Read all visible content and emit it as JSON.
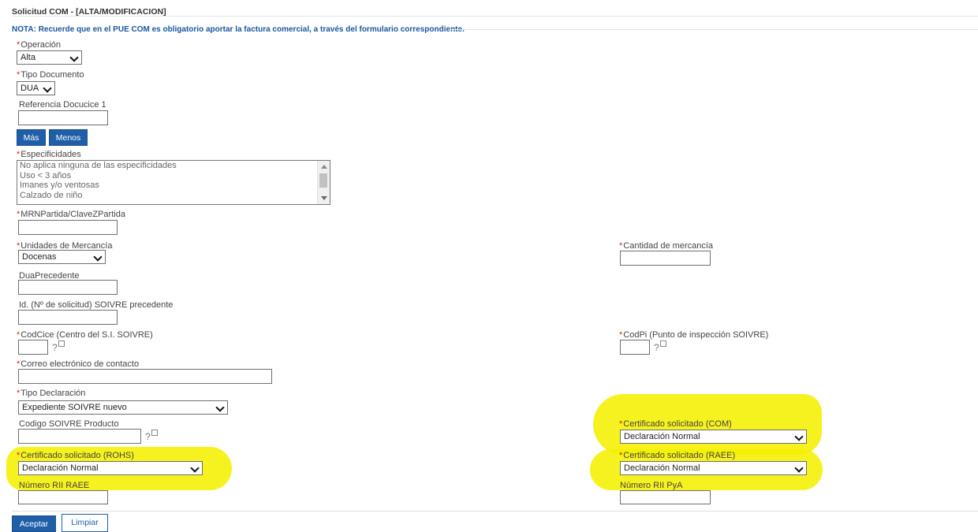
{
  "header": {
    "title": "Solicitud COM - [ALTA/MODIFICACION]",
    "note": "NOTA: Recuerde que en el PUE COM es obligatorio aportar la factura comercial, a través del formulario correspondiente."
  },
  "required_marker": "*",
  "help_icon_text": "?",
  "fields": {
    "operacion": {
      "label": "Operación",
      "value": "Alta"
    },
    "tipo_documento": {
      "label": "Tipo Documento",
      "value": "DUA"
    },
    "referencia": {
      "label": "Referencia Docucice 1",
      "value": ""
    },
    "especificidades": {
      "label": "Especificidades",
      "options": [
        "No aplica ninguna de las especificidades",
        "Uso < 3 años",
        "Imanes y/o ventosas",
        "Calzado de niño"
      ]
    },
    "mrn": {
      "label": "MRNPartida/ClaveZPartida",
      "value": ""
    },
    "unidades": {
      "label": "Unidades de Mercancía",
      "value": "Docenas"
    },
    "cantidad": {
      "label": "Cantidad de mercancía",
      "value": ""
    },
    "dua_precedente": {
      "label": "DuaPrecedente",
      "value": ""
    },
    "id_soivre": {
      "label": "Id. (Nº de solicitud) SOIVRE precedente",
      "value": ""
    },
    "codcice": {
      "label": "CodCice (Centro del S.I. SOIVRE)",
      "value": ""
    },
    "codpi": {
      "label": "CodPi (Punto de inspección SOIVRE)",
      "value": ""
    },
    "correo": {
      "label": "Correo electrónico de contacto",
      "value": ""
    },
    "tipo_declaracion": {
      "label": "Tipo Declaración",
      "value": "Expediente SOIVRE nuevo"
    },
    "codigo_soivre": {
      "label": "Codigo SOIVRE Producto",
      "value": ""
    },
    "cert_com": {
      "label": "Certificado solicitado (COM)",
      "value": "Declaración Normal"
    },
    "cert_rohs": {
      "label": "Certificado solicitado (ROHS)",
      "value": "Declaración Normal"
    },
    "cert_raee": {
      "label": "Certificado solicitado (RAEE)",
      "value": "Declaración Normal"
    },
    "numero_rii_raee": {
      "label": "Número RII RAEE",
      "value": ""
    },
    "numero_rii_pya": {
      "label": "Número RII PyA",
      "value": ""
    }
  },
  "buttons": {
    "mas": "Más",
    "menos": "Menos",
    "aceptar": "Aceptar",
    "limpiar": "Limpiar"
  },
  "colors": {
    "accent": "#1f5fa8",
    "required": "#d9261c",
    "highlight": "#f5f000"
  }
}
